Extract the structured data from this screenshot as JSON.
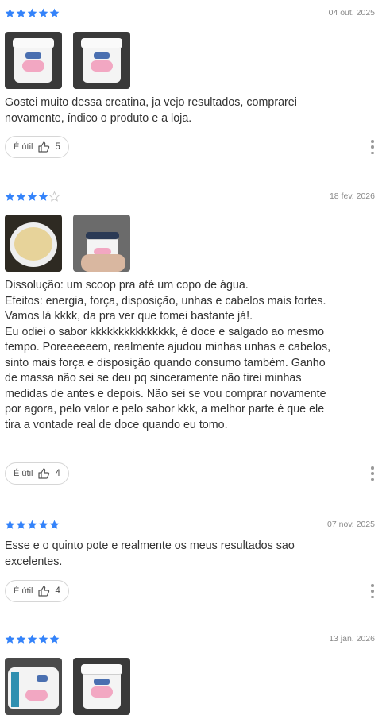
{
  "reviews": [
    {
      "rating": 5,
      "date": "04 out. 2025",
      "photos": [
        "product-photo",
        "product-photo"
      ],
      "text": "Gostei muito dessa creatina, ja vejo resultados, comprarei\nnovamente, índico o produto e a loja.",
      "useful_label": "É útil",
      "useful_count": "5"
    },
    {
      "rating": 4,
      "date": "18 fev. 2026",
      "photos": [
        "product-photo-open",
        "product-photo-hand"
      ],
      "text": "Dissolução: um scoop pra até um copo de água.\nEfeitos: energia, força, disposição, unhas e cabelos mais fortes.\nVamos lá kkkk, da pra ver que tomei bastante já!.\nEu odiei o sabor kkkkkkkkkkkkkkk, é doce e salgado ao mesmo\ntempo. Poreeeeeem, realmente ajudou minhas unhas e cabelos,\nsinto mais força e disposição quando consumo também. Ganho\nde massa não sei se deu pq sinceramente não tirei minhas\nmedidas de antes e depois. Não sei se vou comprar novamente\npor agora, pelo valor e pelo sabor kkk, a melhor parte é que ele\ntira a vontade real de doce quando eu tomo.",
      "useful_label": "É útil",
      "useful_count": "4"
    },
    {
      "rating": 5,
      "date": "07 nov. 2025",
      "photos": [],
      "text": "Esse e o quinto pote e realmente os meus resultados sao\nexcelentes.",
      "useful_label": "É útil",
      "useful_count": "4"
    },
    {
      "rating": 5,
      "date": "13 jan. 2026",
      "photos": [
        "product-photo-side",
        "product-photo"
      ]
    }
  ],
  "colors": {
    "star": "#3483fa",
    "star_empty": "#c7c7c7"
  }
}
